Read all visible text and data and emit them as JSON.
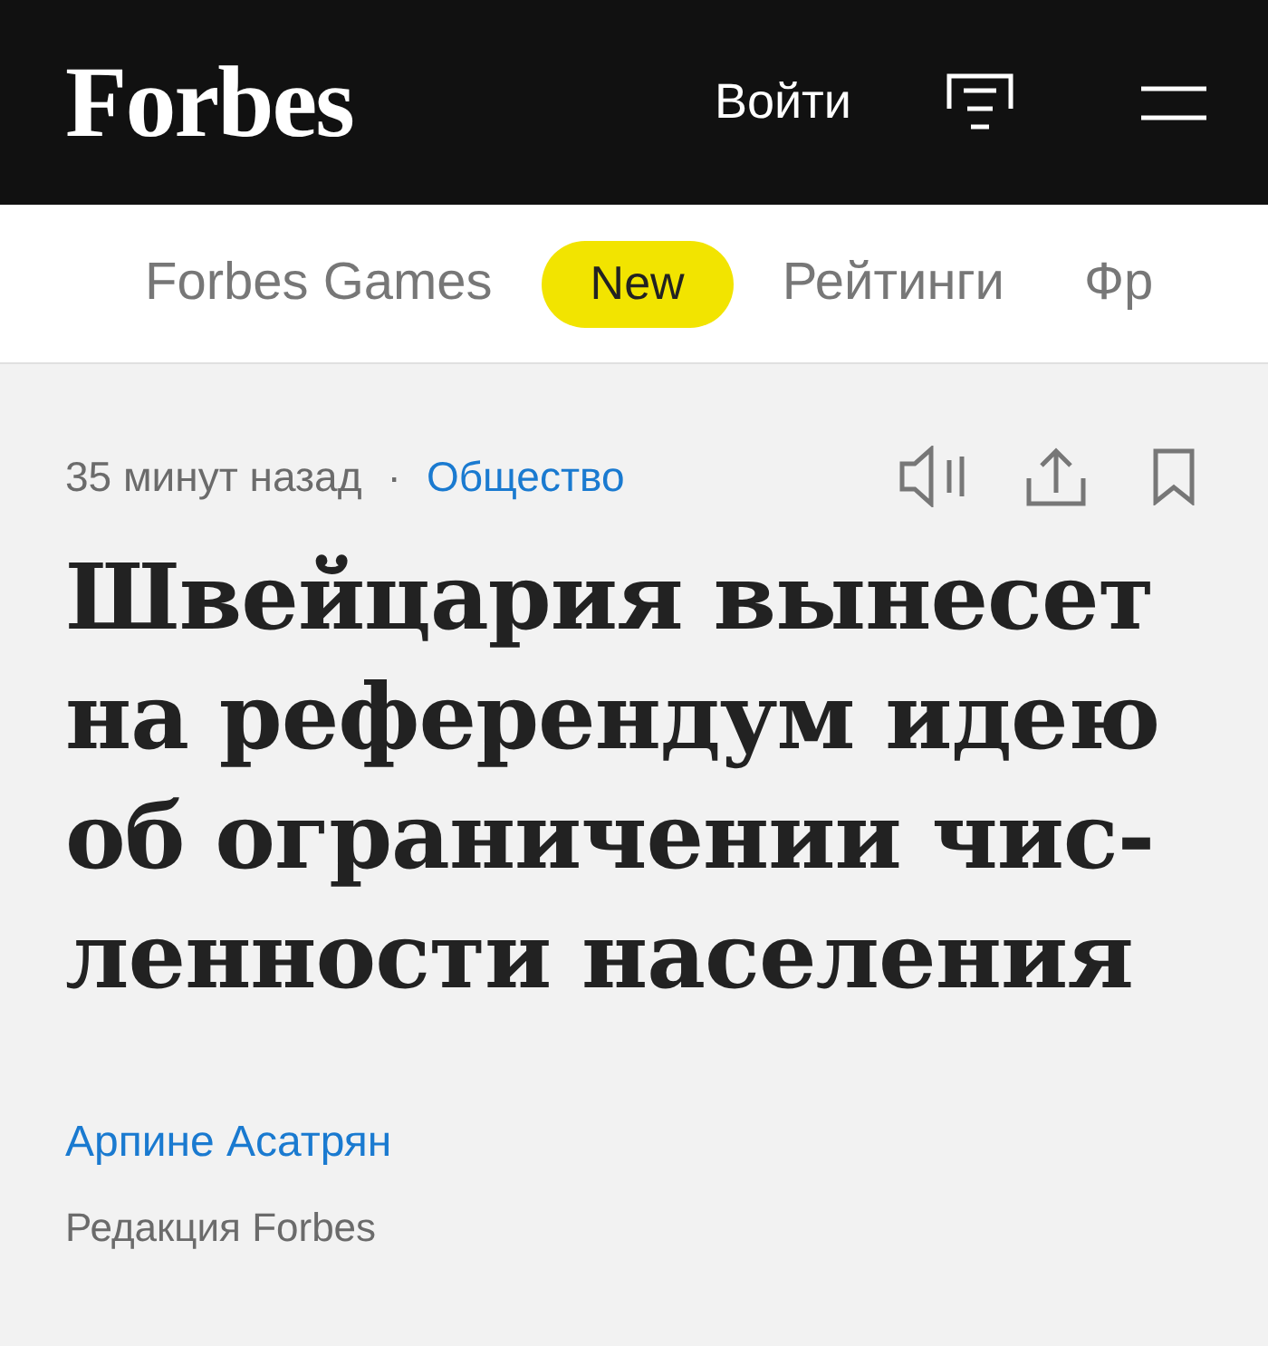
{
  "header": {
    "logo": "Forbes",
    "login": "Войти"
  },
  "nav": [
    {
      "label": "Forbes Games",
      "kind": "link"
    },
    {
      "label": "New",
      "kind": "badge"
    },
    {
      "label": "Рейтинги",
      "kind": "link"
    },
    {
      "label": "Фр",
      "kind": "link"
    }
  ],
  "meta": {
    "time": "35 минут назад",
    "separator": "·",
    "category": "Общество"
  },
  "headline_lines": [
    "Швейцария вынесет",
    "на референдум идею",
    "об ограничении чис-",
    "ленности населения"
  ],
  "author": {
    "name": "Арпине Асатрян",
    "role": "Редакция Forbes"
  }
}
